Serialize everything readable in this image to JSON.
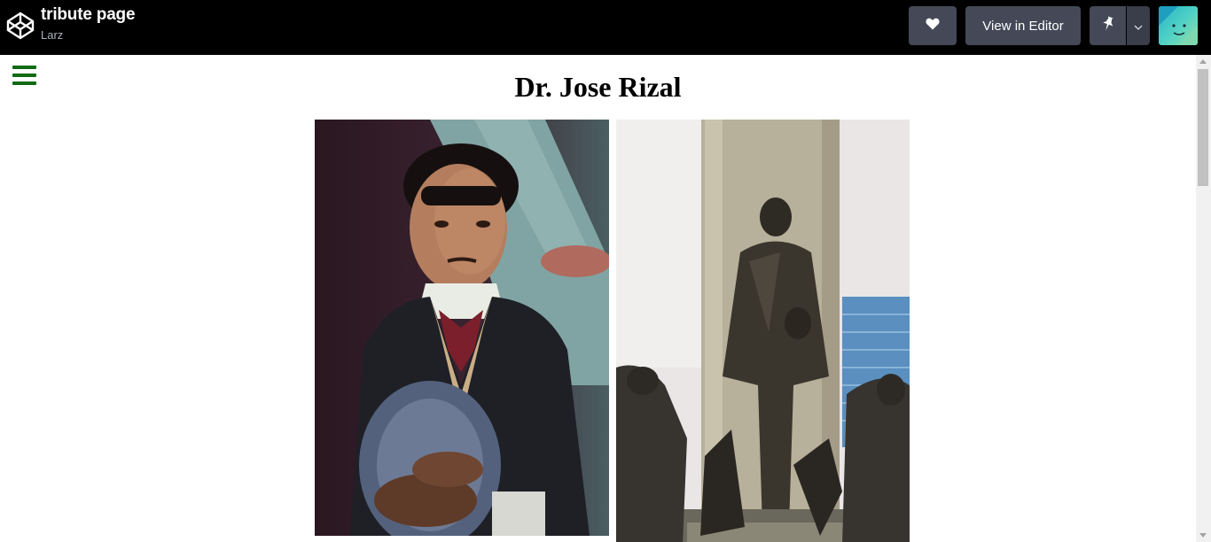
{
  "header": {
    "title": "tribute page",
    "author": "Larz",
    "view_in_editor_label": "View in Editor",
    "icons": {
      "logo": "codepen-logo-icon",
      "heart": "heart-icon",
      "pin": "pin-icon",
      "caret": "chevron-down-icon",
      "avatar": "user-avatar"
    }
  },
  "page": {
    "heading": "Dr. Jose Rizal",
    "menu_icon": "hamburger-menu-icon",
    "menu_color": "#0d6b13",
    "images": [
      {
        "name": "portrait-photo",
        "alt": "Portrait of Dr. Jose Rizal"
      },
      {
        "name": "monument-photo",
        "alt": "Rizal Monument statue"
      }
    ]
  },
  "colors": {
    "topbar_bg": "#000000",
    "button_bg": "#444857",
    "page_bg": "#ffffff"
  }
}
